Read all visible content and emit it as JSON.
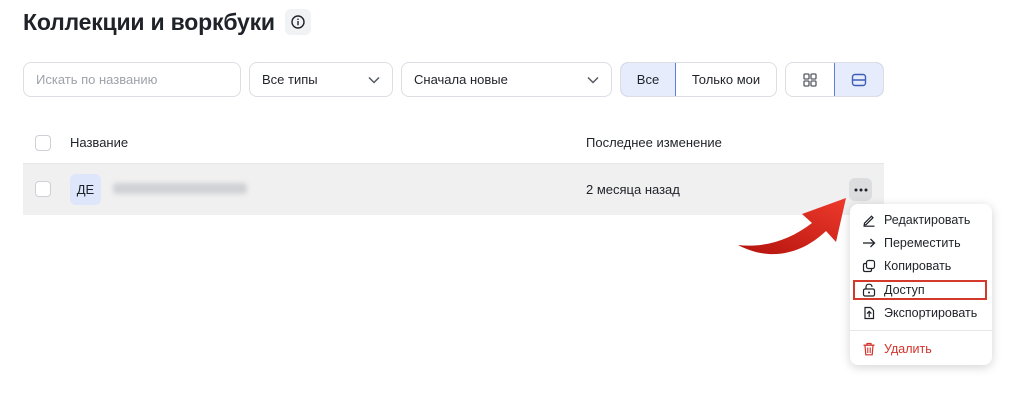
{
  "header": {
    "title": "Коллекции и воркбуки",
    "info_icon": "info-icon"
  },
  "toolbar": {
    "search_placeholder": "Искать по названию",
    "type_filter": "Все типы",
    "sort": "Сначала новые",
    "scope_all": "Все",
    "scope_mine": "Только мои",
    "selected_scope": "Все",
    "view_grid_icon": "grid-view-icon",
    "view_list_icon": "list-view-icon",
    "selected_view": "list"
  },
  "table": {
    "columns": [
      "Название",
      "Последнее изменение"
    ],
    "rows": [
      {
        "avatar": "ДЕ",
        "name_blurred": true,
        "modified": "2 месяца назад"
      }
    ]
  },
  "context_menu": {
    "items": [
      {
        "label": "Редактировать",
        "icon": "pencil-icon"
      },
      {
        "label": "Переместить",
        "icon": "arrow-right-icon"
      },
      {
        "label": "Копировать",
        "icon": "copy-icon"
      },
      {
        "label": "Доступ",
        "icon": "lock-icon",
        "highlighted": true
      },
      {
        "label": "Экспортировать",
        "icon": "export-icon"
      }
    ],
    "delete": {
      "label": "Удалить",
      "icon": "trash-icon"
    }
  },
  "colors": {
    "accent": "#5c7fd9",
    "accent_bg": "#e6ecfb",
    "danger": "#d4322a",
    "highlight_border": "#d43a2c",
    "row_bg": "#f0f0f0"
  }
}
